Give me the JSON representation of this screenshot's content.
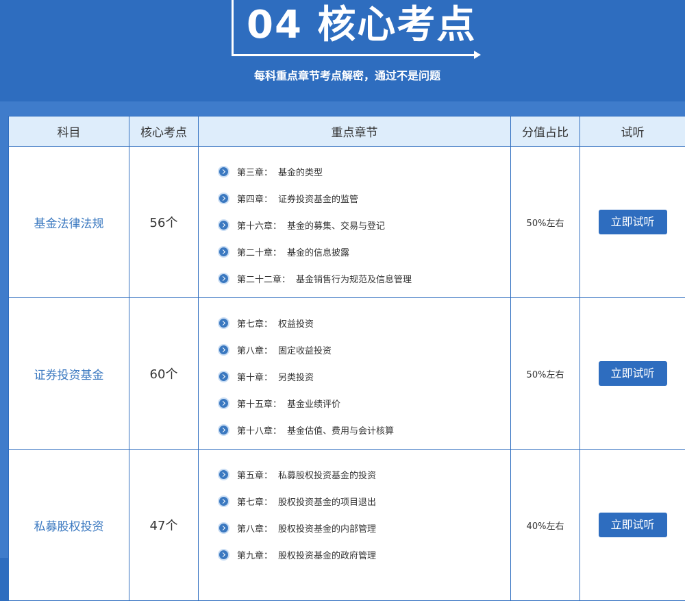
{
  "header": {
    "title": "04 核心考点",
    "subtitle": "每科重点章节考点解密，通过不是问题"
  },
  "table": {
    "columns": [
      "科目",
      "核心考点",
      "重点章节",
      "分值占比",
      "试听"
    ],
    "rows": [
      {
        "subject": "基金法律法规",
        "count": "56个",
        "ratio": "50%左右",
        "button": "立即试听",
        "chapters": [
          {
            "chapter": "第三章：",
            "name": "基金的类型"
          },
          {
            "chapter": "第四章：",
            "name": "证券投资基金的监管"
          },
          {
            "chapter": "第十六章：",
            "name": "基金的募集、交易与登记"
          },
          {
            "chapter": "第二十章：",
            "name": "基金的信息披露"
          },
          {
            "chapter": "第二十二章：",
            "name": "基金销售行为规范及信息管理"
          }
        ]
      },
      {
        "subject": "证券投资基金",
        "count": "60个",
        "ratio": "50%左右",
        "button": "立即试听",
        "chapters": [
          {
            "chapter": "第七章：",
            "name": "权益投资"
          },
          {
            "chapter": "第八章：",
            "name": "固定收益投资"
          },
          {
            "chapter": "第十章：",
            "name": "另类投资"
          },
          {
            "chapter": "第十五章：",
            "name": "基金业绩评价"
          },
          {
            "chapter": "第十八章：",
            "name": "基金估值、费用与会计核算"
          }
        ]
      },
      {
        "subject": "私募股权投资",
        "count": "47个",
        "ratio": "40%左右",
        "button": "立即试听",
        "chapters": [
          {
            "chapter": "第五章：",
            "name": "私募股权投资基金的投资"
          },
          {
            "chapter": "第七章：",
            "name": "股权投资基金的项目退出"
          },
          {
            "chapter": "第八章：",
            "name": "股权投资基金的内部管理"
          },
          {
            "chapter": "第九章：",
            "name": "股权投资基金的政府管理"
          }
        ]
      }
    ]
  }
}
